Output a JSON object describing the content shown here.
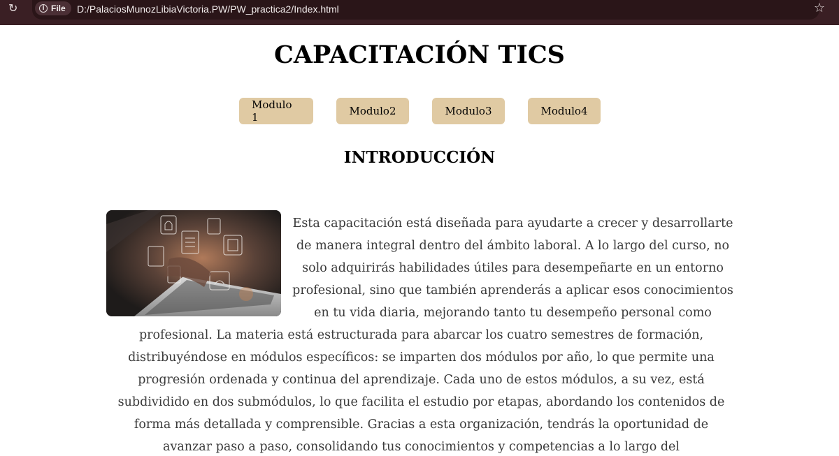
{
  "browser": {
    "file_label": "File",
    "url": "D:/PalaciosMunozLibiaVictoria.PW/PW_practica2/Index.html"
  },
  "header": {
    "title": "CAPACITACIÓN TICS"
  },
  "nav": {
    "items": [
      "Modulo 1",
      "Modulo2",
      "Modulo3",
      "Modulo4"
    ]
  },
  "main": {
    "section_title": "INTRODUCCIÓN",
    "intro_text": "Esta capacitación está diseñada para ayudarte a crecer y desarrollarte de manera integral dentro del ámbito laboral. A lo largo del curso, no solo adquirirás habilidades útiles para desempeñarte en un entorno profesional, sino que también aprenderás a aplicar esos conocimientos en tu vida diaria, mejorando tanto tu desempeño personal como profesional. La materia está estructurada para abarcar los cuatro semestres de formación, distribuyéndose en módulos específicos: se imparten dos módulos por año, lo que permite una progresión ordenada y continua del aprendizaje. Cada uno de estos módulos, a su vez, está subdividido en dos submódulos, lo que facilita el estudio por etapas, abordando los contenidos de forma más detallada y comprensible. Gracias a esta organización, tendrás la oportunidad de avanzar paso a paso, consolidando tus conocimientos y competencias a lo largo del"
  },
  "colors": {
    "browser_bar": "#3a1f24",
    "nav_button": "#e0caa3",
    "text": "#3a3a3a"
  }
}
